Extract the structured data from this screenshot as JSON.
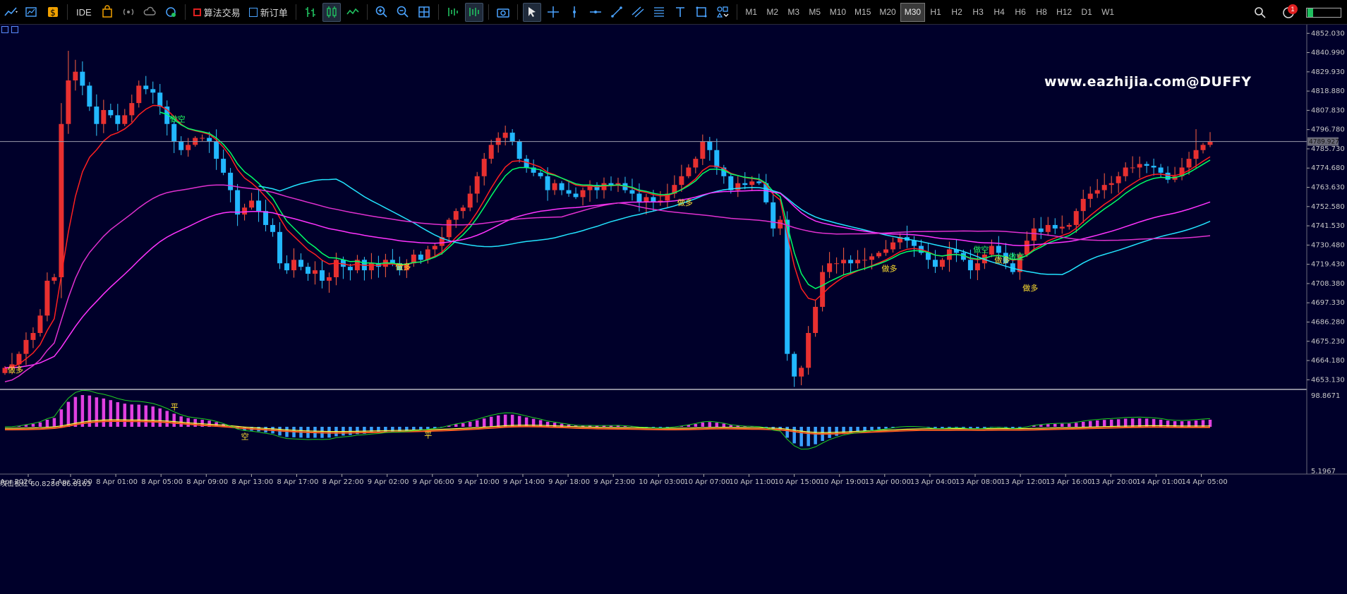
{
  "toolbar": {
    "ide_label": "IDE",
    "algo_label": "算法交易",
    "new_order_label": "新订单",
    "timeframes": [
      "M1",
      "M2",
      "M3",
      "M5",
      "M10",
      "M15",
      "M20",
      "M30",
      "H1",
      "H2",
      "H3",
      "H4",
      "H6",
      "H8",
      "H12",
      "D1",
      "W1"
    ],
    "active_timeframe": "M30",
    "notification_count": "1"
  },
  "watermark": "www.eazhijia.com@DUFFY",
  "indicator_label": "攻击板红 60.8286 86.8163",
  "current_price": "4789.927",
  "chart_data": [
    {
      "type": "candlestick",
      "price_axis_ticks": [
        "4852.030",
        "4840.990",
        "4829.930",
        "4818.880",
        "4807.830",
        "4796.780",
        "4785.730",
        "4774.680",
        "4763.630",
        "4752.580",
        "4741.530",
        "4730.480",
        "4719.430",
        "4708.380",
        "4697.330",
        "4686.280",
        "4675.230",
        "4664.180",
        "4653.130"
      ],
      "time_axis_ticks": [
        "Apr 2026",
        "7 Apr 20:00",
        "8 Apr 01:00",
        "8 Apr 05:00",
        "8 Apr 09:00",
        "8 Apr 13:00",
        "8 Apr 17:00",
        "8 Apr 22:00",
        "9 Apr 02:00",
        "9 Apr 06:00",
        "9 Apr 10:00",
        "9 Apr 14:00",
        "9 Apr 18:00",
        "9 Apr 23:00",
        "10 Apr 03:00",
        "10 Apr 07:00",
        "10 Apr 11:00",
        "10 Apr 15:00",
        "10 Apr 19:00",
        "13 Apr 00:00",
        "13 Apr 04:00",
        "13 Apr 08:00",
        "13 Apr 12:00",
        "13 Apr 16:00",
        "13 Apr 20:00",
        "14 Apr 01:00",
        "14 Apr 05:00"
      ],
      "ylim": [
        4648,
        4857
      ],
      "close": [
        4660,
        4662,
        4668,
        4676,
        4680,
        4690,
        4710,
        4712,
        4800,
        4825,
        4830,
        4822,
        4810,
        4800,
        4808,
        4805,
        4800,
        4805,
        4812,
        4822,
        4820,
        4818,
        4810,
        4800,
        4790,
        4785,
        4788,
        4792,
        4792,
        4790,
        4780,
        4772,
        4762,
        4748,
        4752,
        4756,
        4750,
        4742,
        4738,
        4720,
        4716,
        4722,
        4718,
        4714,
        4716,
        4710,
        4712,
        4722,
        4718,
        4716,
        4722,
        4716,
        4720,
        4718,
        4722,
        4720,
        4716,
        4720,
        4725,
        4722,
        4728,
        4730,
        4735,
        4745,
        4750,
        4752,
        4760,
        4770,
        4780,
        4788,
        4792,
        4795,
        4790,
        4780,
        4775,
        4772,
        4770,
        4762,
        4766,
        4762,
        4760,
        4758,
        4762,
        4765,
        4762,
        4766,
        4765,
        4766,
        4762,
        4760,
        4755,
        4758,
        4755,
        4756,
        4760,
        4765,
        4770,
        4775,
        4780,
        4790,
        4785,
        4775,
        4770,
        4762,
        4766,
        4765,
        4767,
        4766,
        4755,
        4740,
        4745,
        4668,
        4655,
        4660,
        4680,
        4695,
        4715,
        4720,
        4720,
        4722,
        4720,
        4722,
        4722,
        4724,
        4726,
        4728,
        4732,
        4735,
        4733,
        4730,
        4726,
        4722,
        4718,
        4722,
        4728,
        4726,
        4722,
        4716,
        4720,
        4725,
        4730,
        4726,
        4720,
        4715,
        4725,
        4733,
        4740,
        4738,
        4742,
        4740,
        4741,
        4742,
        4750,
        4757,
        4760,
        4762,
        4765,
        4766,
        4770,
        4775,
        4775,
        4777,
        4776,
        4775,
        4772,
        4768,
        4770,
        4775,
        4780,
        4785,
        4788,
        4790
      ],
      "moving_averages": [
        {
          "color": "#ff2020"
        },
        {
          "color": "#00ff66"
        },
        {
          "color": "#22e4ff"
        },
        {
          "color": "#ff33ff"
        },
        {
          "color": "#e030d0"
        }
      ],
      "signal_labels": [
        "做空",
        "做多"
      ],
      "signals": [
        {
          "label": "做多",
          "index": 1,
          "price": 4659
        },
        {
          "label": "做空",
          "index": 24,
          "price": 4803
        },
        {
          "label": "做多",
          "index": 56,
          "price": 4718
        },
        {
          "label": "做多",
          "index": 96,
          "price": 4755
        },
        {
          "label": "做多",
          "index": 125,
          "price": 4717
        },
        {
          "label": "做空",
          "index": 138,
          "price": 4728
        },
        {
          "label": "做多",
          "index": 141,
          "price": 4722
        },
        {
          "label": "做空",
          "index": 143,
          "price": 4724
        },
        {
          "label": "做多",
          "index": 145,
          "price": 4706
        }
      ]
    },
    {
      "type": "histogram",
      "title": "攻击板红",
      "values_label": [
        "60.8286",
        "86.8163"
      ],
      "axis_ticks": [
        "98.8671",
        "5.1967"
      ],
      "signal_labels": [
        "平",
        "空",
        "平"
      ],
      "signals": [
        {
          "label": "平",
          "index": 24
        },
        {
          "label": "空",
          "index": 34
        },
        {
          "label": "平",
          "index": 60
        }
      ]
    }
  ]
}
